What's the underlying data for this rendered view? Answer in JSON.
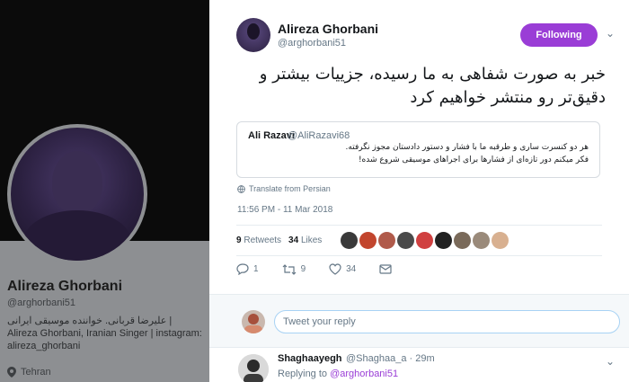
{
  "profile_bg": {
    "name": "Alireza Ghorbani",
    "handle": "@arghorbani51",
    "bio": "علیرضا قربانی. خواننده موسیقی ایرانی | Alireza Ghorbani, Iranian Singer | instagram: alireza_ghorbani",
    "location": "Tehran"
  },
  "tweet": {
    "author_name": "Alireza Ghorbani",
    "author_handle": "@arghorbani51",
    "follow_label": "Following",
    "text": "خبر به صورت شفاهی به ما رسیده، جزییات بیشتر و دقیق‌تر رو منتشر خواهیم کرد",
    "quote": {
      "name": "Ali Razavi",
      "handle": "@AliRazavi68",
      "line1": "هر دو کنسرت ساری و طرقبه ما با فشار و دستور دادستان مجوز نگرفته.",
      "line2": "فکر میکنم دور تازه‌ای از فشارها برای اجراهای موسیقی شروع شده!"
    },
    "translate_label": "Translate from Persian",
    "timestamp": "11:56 PM - 11 Mar 2018",
    "retweets_count": "9",
    "retweets_label": "Retweets",
    "likes_count": "34",
    "likes_label": "Likes",
    "replies_action_count": "1",
    "retweet_action_count": "9",
    "like_action_count": "34"
  },
  "likers_colors": [
    "#3a3a3a",
    "#c2452d",
    "#b05a4a",
    "#4a4a4a",
    "#d04040",
    "#222222",
    "#7a6a5a",
    "#9a8a7a",
    "#d8b090"
  ],
  "reply_box": {
    "placeholder": "Tweet your reply"
  },
  "first_reply": {
    "name": "Shaghaayegh",
    "meta": "@Shaghaa_a · 29m",
    "replying_label": "Replying to",
    "replying_handle": "@arghorbani51"
  },
  "colors": {
    "accent": "#9a3dd6",
    "muted": "#657786"
  }
}
